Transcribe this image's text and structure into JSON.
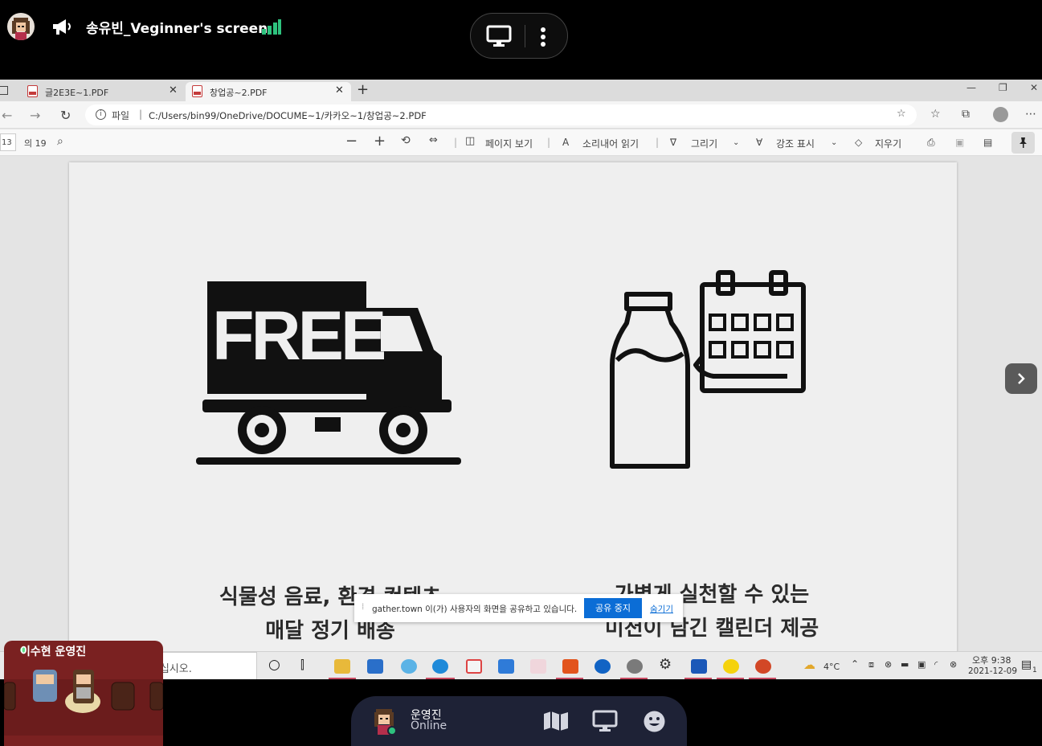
{
  "gather": {
    "presenter_label": "송유빈_Veginner's screen",
    "screen_menu_icons": [
      "monitor-icon",
      "more-vertical-icon"
    ],
    "accent_green": "#2ec27e"
  },
  "browser": {
    "tabs": [
      {
        "label": "글2E3E~1.PDF"
      },
      {
        "label": "창업공~2.PDF"
      }
    ],
    "address": {
      "scheme_label": "파일",
      "separator": "|",
      "url": "C:/Users/bin99/OneDrive/DOCUME~1/카카오~1/창업공~2.PDF"
    },
    "pdf_toolbar": {
      "page_current": "13",
      "page_total": "의 19",
      "zoom_out": "−",
      "zoom_in": "+",
      "page_view": "페이지 보기",
      "read_aloud": "소리내어 읽기",
      "draw": "그리기",
      "highlight": "강조 표시",
      "erase": "지우기"
    }
  },
  "slide": {
    "left_caption_line1": "식물성 음료, 환경 컨텐츠",
    "left_caption_line2": "매달 정기 배송",
    "right_caption_line1": "가볍게 실천할 수 있는",
    "right_caption_line2": "미션이 담긴 캘린더 제공",
    "truck_text": "FREE"
  },
  "share_notice": {
    "message": "gather.town 이(가) 사용자의 화면을 공유하고 있습니다.",
    "stop_button": "공유 중지",
    "hide_link": "숨기기"
  },
  "taskbar": {
    "search_placeholder": "검색하려면 여기에 입력하십시오.",
    "temperature": "4°C",
    "time": "오후 9:38",
    "date": "2021-12-09",
    "notification_count": "1"
  },
  "minimap": {
    "title": "이수현 운영진"
  },
  "bottom_bar": {
    "user_name": "운영진",
    "user_status": "Online"
  }
}
